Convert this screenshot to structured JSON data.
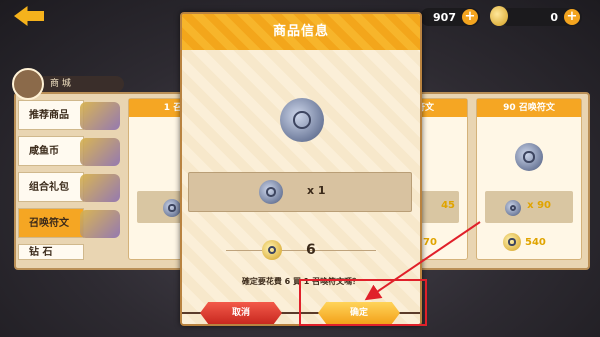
{
  "topbar": {
    "resource1": {
      "value": "907",
      "plus": "+"
    },
    "resource2": {
      "value": "0",
      "plus": "+"
    }
  },
  "shop": {
    "title": "商 城",
    "sidebar": [
      {
        "label": "推荐商品"
      },
      {
        "label": "咸鱼币"
      },
      {
        "label": "组合礼包"
      },
      {
        "label": "召唤符文",
        "active": true
      },
      {
        "label": "钻 石"
      }
    ],
    "cards": [
      {
        "title": "1 召",
        "qty": "",
        "price": ""
      },
      {
        "title": "符文",
        "qty": "45",
        "price": "70"
      },
      {
        "title": "90 召唤符文",
        "qty": "x 90",
        "price": "540"
      }
    ]
  },
  "modal": {
    "title": "商品信息",
    "item_qty": "x 1",
    "price": "6",
    "confirm_text": "確定要花費 6 買 1 召喚符文嗎？",
    "cancel_label": "取消",
    "ok_label": "确定"
  },
  "colors": {
    "accent": "#f5a623",
    "annotation": "#e0202a"
  }
}
